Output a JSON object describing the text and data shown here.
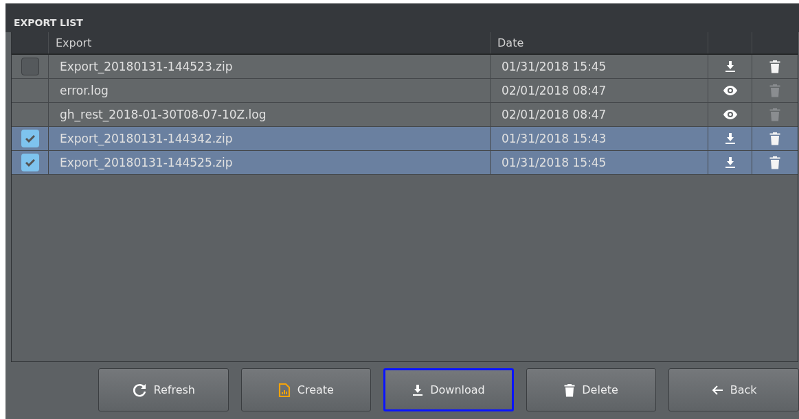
{
  "panel": {
    "title": "EXPORT LIST"
  },
  "table": {
    "columns": [
      "Export",
      "Date"
    ],
    "rows": [
      {
        "kind": "checkable",
        "checked": false,
        "selected": false,
        "name": "Export_20180131-144523.zip",
        "date": "01/31/2018 15:45",
        "action": {
          "kind": "download"
        },
        "delete_disabled": false
      },
      {
        "kind": "plain",
        "selected": false,
        "name": "error.log",
        "date": "02/01/2018 08:47",
        "action": {
          "kind": "view"
        },
        "delete_disabled": true
      },
      {
        "kind": "plain",
        "selected": false,
        "name": "gh_rest_2018-01-30T08-07-10Z.log",
        "date": "02/01/2018 08:47",
        "action": {
          "kind": "view"
        },
        "delete_disabled": true
      },
      {
        "kind": "checkable",
        "checked": true,
        "selected": true,
        "name": "Export_20180131-144342.zip",
        "date": "01/31/2018 15:43",
        "action": {
          "kind": "download"
        },
        "delete_disabled": false
      },
      {
        "kind": "checkable",
        "checked": true,
        "selected": true,
        "name": "Export_20180131-144525.zip",
        "date": "01/31/2018 15:45",
        "action": {
          "kind": "download"
        },
        "delete_disabled": false
      }
    ]
  },
  "buttons": [
    {
      "kind": "refresh",
      "label": "Refresh",
      "focused": false
    },
    {
      "kind": "create",
      "label": "Create",
      "focused": false
    },
    {
      "kind": "download",
      "label": "Download",
      "focused": true
    },
    {
      "kind": "delete",
      "label": "Delete",
      "focused": false
    },
    {
      "kind": "back",
      "label": "Back",
      "focused": false
    }
  ]
}
